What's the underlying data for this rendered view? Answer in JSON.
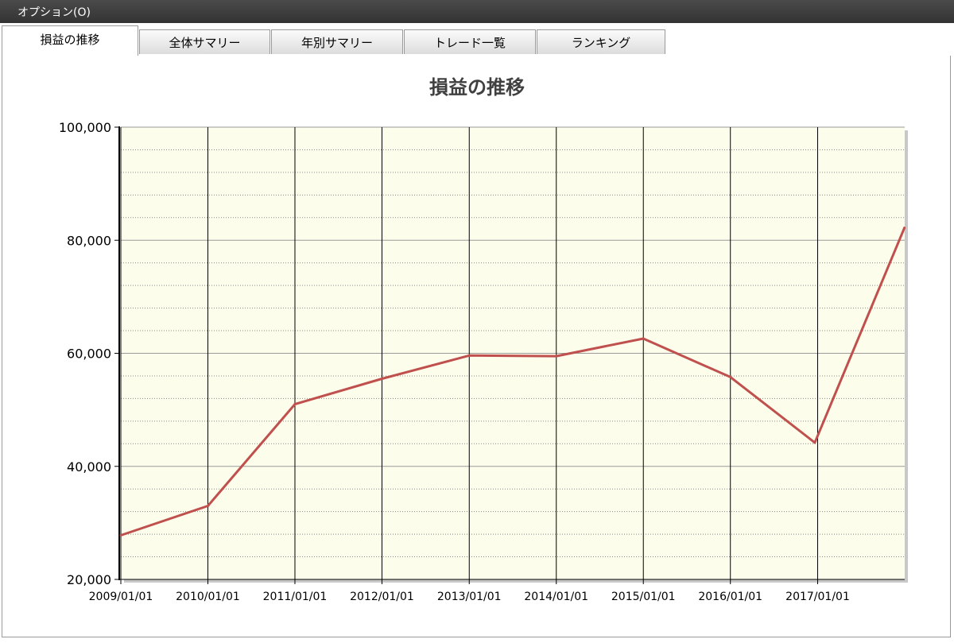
{
  "menu": {
    "options_label": "オプション(O)"
  },
  "tabs": [
    {
      "label": "損益の推移",
      "active": true
    },
    {
      "label": "全体サマリー",
      "active": false
    },
    {
      "label": "年別サマリー",
      "active": false
    },
    {
      "label": "トレード一覧",
      "active": false
    },
    {
      "label": "ランキング",
      "active": false
    }
  ],
  "colors": {
    "plot_background": "#fdfdec",
    "line": "#c0504d",
    "title": "#404040"
  },
  "chart_data": {
    "type": "line",
    "title": "損益の推移",
    "xlabel": "",
    "ylabel": "",
    "ylim": [
      20000,
      100000
    ],
    "y_ticks": [
      "20,000",
      "40,000",
      "60,000",
      "80,000",
      "100,000"
    ],
    "x_ticks": [
      "2009/01/01",
      "2010/01/01",
      "2011/01/01",
      "2012/01/01",
      "2013/01/01",
      "2014/01/01",
      "2015/01/01",
      "2016/01/01",
      "2017/01/01"
    ],
    "grid": true,
    "series": [
      {
        "x": [
          "2009/01/01",
          "2010/01/01",
          "2011/01/01",
          "2012/01/01",
          "2013/01/01",
          "2014/01/01",
          "2015/01/01",
          "2016/01/01",
          "2016/12/20",
          "2017/12/31"
        ],
        "values": [
          27800,
          33000,
          51000,
          55500,
          59600,
          59500,
          62600,
          55800,
          44200,
          82200
        ]
      }
    ]
  }
}
